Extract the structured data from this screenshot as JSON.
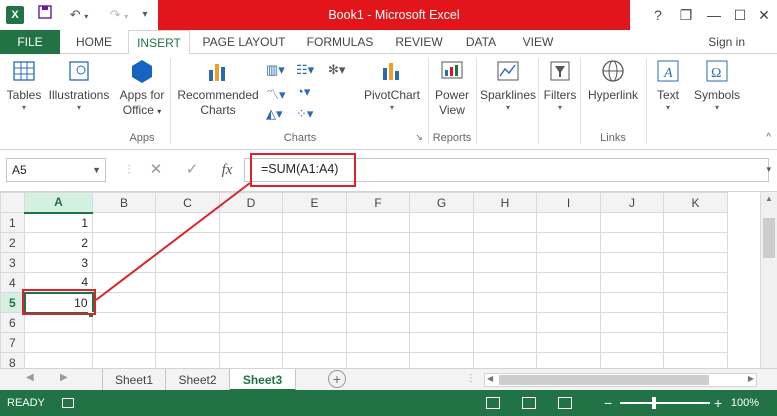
{
  "app": {
    "title": "Book1 - Microsoft Excel",
    "signin": "Sign in",
    "brand_color": "#217346",
    "title_color": "#e2161a"
  },
  "quick_access": [
    "excel-icon",
    "save-icon",
    "undo-icon",
    "redo-icon"
  ],
  "window_controls": {
    "help": "?",
    "minimize": "—",
    "restore": "❐",
    "close": "✕"
  },
  "tabs": [
    {
      "label": "FILE"
    },
    {
      "label": "HOME"
    },
    {
      "label": "INSERT"
    },
    {
      "label": "PAGE LAYOUT"
    },
    {
      "label": "FORMULAS"
    },
    {
      "label": "REVIEW"
    },
    {
      "label": "DATA"
    },
    {
      "label": "VIEW"
    }
  ],
  "ribbon": {
    "tables": "Tables",
    "illustrations": "Illustrations",
    "apps_for_office_1": "Apps for",
    "apps_for_office_2": "Office",
    "recommended_charts_1": "Recommended",
    "recommended_charts_2": "Charts",
    "pivotchart": "PivotChart",
    "power_view_1": "Power",
    "power_view_2": "View",
    "sparklines": "Sparklines",
    "filters": "Filters",
    "hyperlink": "Hyperlink",
    "text": "Text",
    "symbols": "Symbols",
    "groups": {
      "apps": "Apps",
      "charts": "Charts",
      "reports": "Reports",
      "links": "Links"
    }
  },
  "formula_bar": {
    "name_box": "A5",
    "cancel": "✕",
    "enter": "✓",
    "fx": "fx",
    "formula": "=SUM(A1:A4)"
  },
  "grid": {
    "columns": [
      "A",
      "B",
      "C",
      "D",
      "E",
      "F",
      "G",
      "H",
      "I",
      "J",
      "K"
    ],
    "rows": [
      {
        "num": "1",
        "a": "1"
      },
      {
        "num": "2",
        "a": "2"
      },
      {
        "num": "3",
        "a": "3"
      },
      {
        "num": "4",
        "a": "4"
      },
      {
        "num": "5",
        "a": "10"
      },
      {
        "num": "6",
        "a": ""
      },
      {
        "num": "7",
        "a": ""
      },
      {
        "num": "8",
        "a": ""
      }
    ]
  },
  "sheets": [
    "Sheet1",
    "Sheet2",
    "Sheet3"
  ],
  "status": {
    "ready": "READY",
    "zoom": "100%"
  }
}
